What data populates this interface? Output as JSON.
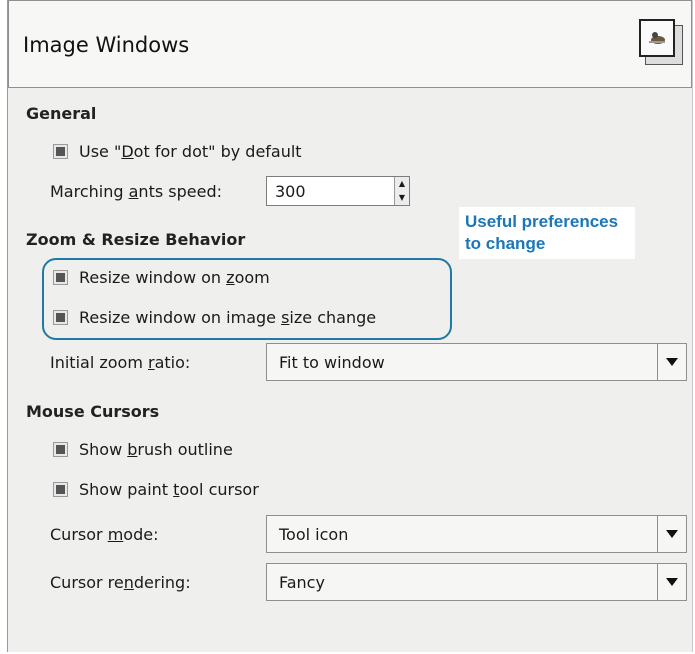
{
  "header": {
    "title": "Image Windows"
  },
  "general": {
    "title": "General",
    "dot_for_dot": {
      "pre": "Use \"",
      "u": "D",
      "post": "ot for dot\" by default"
    },
    "ants_speed": {
      "pre": "Marching ",
      "u": "a",
      "post": "nts speed:",
      "value": "300"
    }
  },
  "zoom": {
    "title": "Zoom & Resize Behavior",
    "resize_on_zoom": {
      "pre": "Resize window on ",
      "u": "z",
      "post": "oom"
    },
    "resize_on_size": {
      "pre": "Resize window on image ",
      "u": "s",
      "post": "ize change"
    },
    "initial_ratio": {
      "pre": "Initial zoom ",
      "u": "r",
      "post": "atio:",
      "value": "Fit to window"
    }
  },
  "mouse": {
    "title": "Mouse Cursors",
    "brush_outline": {
      "pre": "Show ",
      "u": "b",
      "post": "rush outline"
    },
    "paint_cursor": {
      "pre": "Show paint ",
      "u": "t",
      "post": "ool cursor"
    },
    "cursor_mode": {
      "pre": "Cursor ",
      "u": "m",
      "post": "ode:",
      "value": "Tool icon"
    },
    "cursor_rendering": {
      "pre": "Cursor re",
      "u": "n",
      "post": "dering:",
      "value": "Fancy"
    }
  },
  "callout": {
    "line1": "Useful preferences",
    "line2": "to change"
  },
  "icons": {
    "header": "image-windows-icon",
    "checkbox": "checkbox-checked",
    "dropdown": "dropdown-arrow"
  }
}
